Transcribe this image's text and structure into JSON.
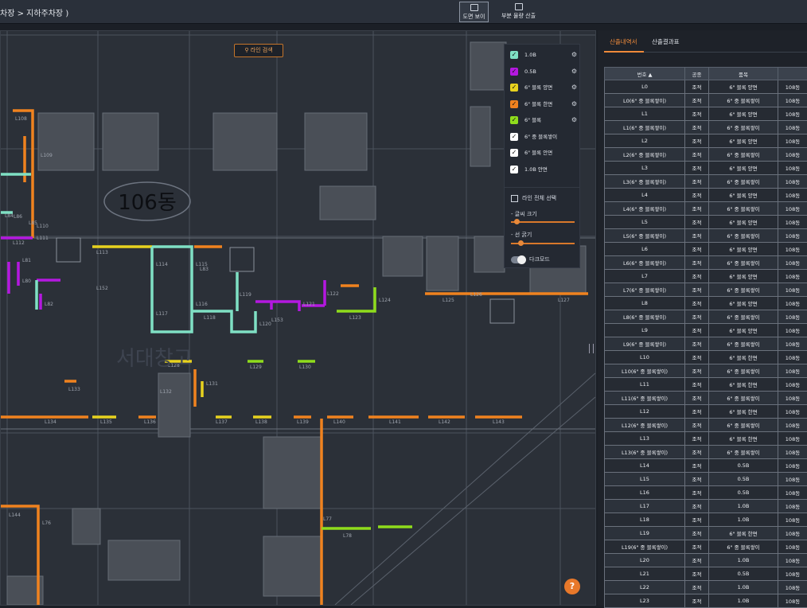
{
  "breadcrumb": "차장 > 지하주차장 )",
  "toolbar": {
    "view_label": "도면 보이",
    "view_icon": "print-icon",
    "partial_label": "부분 물량 산출",
    "partial_icon": "document-icon"
  },
  "plan": {
    "search_label": "라인 검색",
    "building_label": "106동",
    "room_label": "서대창고",
    "line_labels": [
      "L108",
      "L109",
      "L110",
      "L111",
      "L112",
      "L113",
      "L114",
      "L115",
      "L116",
      "L117",
      "L118",
      "L119",
      "L120",
      "L121",
      "L122",
      "L123",
      "L124",
      "L125",
      "L126",
      "L127",
      "L128",
      "L129",
      "L130",
      "L131",
      "L132",
      "L133",
      "L134",
      "L135",
      "L136",
      "L137",
      "L138",
      "L139",
      "L140",
      "L141",
      "L142",
      "L143",
      "L144",
      "L76",
      "L77",
      "L78",
      "L80",
      "L81",
      "L82",
      "L83",
      "L84",
      "L85",
      "L86",
      "L152",
      "L153"
    ]
  },
  "legend": [
    {
      "label": "1.0B",
      "color": "#7fe0c4"
    },
    {
      "label": "0.5B",
      "color": "#b418e0"
    },
    {
      "label": "6\" 블록 양면",
      "color": "#e8d21f"
    },
    {
      "label": "6\" 블록 한면",
      "color": "#f0821f"
    },
    {
      "label": "6\" 블록",
      "color": "#8fdc1c"
    },
    {
      "label": "6\" 중 블록쌓이",
      "color": "#ffffff"
    },
    {
      "label": "6\" 블록 안면",
      "color": "#ffffff"
    },
    {
      "label": "1.0B 안면",
      "color": "#ffffff"
    }
  ],
  "controls": {
    "select_all": "라인 전체 선택",
    "font_size": "- 글씨 크기",
    "line_width": "- 선 굵기",
    "dark_mode": "다크모드"
  },
  "help": "?",
  "panel": {
    "tabs": [
      "산출내역서",
      "산출결과표"
    ],
    "columns": [
      "번호 ▲",
      "공종",
      "품목",
      ""
    ],
    "rows": [
      [
        "L0",
        "조적",
        "6\" 블록 양면",
        "108동"
      ],
      [
        "L0(6\" 중 블록쌓이)",
        "조적",
        "6\" 중 블록쌓이",
        "108동"
      ],
      [
        "L1",
        "조적",
        "6\" 블록 양면",
        "108동"
      ],
      [
        "L1(6\" 중 블록쌓이)",
        "조적",
        "6\" 중 블록쌓이",
        "108동"
      ],
      [
        "L2",
        "조적",
        "6\" 블록 양면",
        "108동"
      ],
      [
        "L2(6\" 중 블록쌓이)",
        "조적",
        "6\" 중 블록쌓이",
        "108동"
      ],
      [
        "L3",
        "조적",
        "6\" 블록 양면",
        "108동"
      ],
      [
        "L3(6\" 중 블록쌓이)",
        "조적",
        "6\" 중 블록쌓이",
        "108동"
      ],
      [
        "L4",
        "조적",
        "6\" 블록 양면",
        "108동"
      ],
      [
        "L4(6\" 중 블록쌓이)",
        "조적",
        "6\" 중 블록쌓이",
        "108동"
      ],
      [
        "L5",
        "조적",
        "6\" 블록 양면",
        "108동"
      ],
      [
        "L5(6\" 중 블록쌓이)",
        "조적",
        "6\" 중 블록쌓이",
        "108동"
      ],
      [
        "L6",
        "조적",
        "6\" 블록 양면",
        "108동"
      ],
      [
        "L6(6\" 중 블록쌓이)",
        "조적",
        "6\" 중 블록쌓이",
        "108동"
      ],
      [
        "L7",
        "조적",
        "6\" 블록 양면",
        "108동"
      ],
      [
        "L7(6\" 중 블록쌓이)",
        "조적",
        "6\" 중 블록쌓이",
        "108동"
      ],
      [
        "L8",
        "조적",
        "6\" 블록 양면",
        "108동"
      ],
      [
        "L8(6\" 중 블록쌓이)",
        "조적",
        "6\" 중 블록쌓이",
        "108동"
      ],
      [
        "L9",
        "조적",
        "6\" 블록 양면",
        "108동"
      ],
      [
        "L9(6\" 중 블록쌓이)",
        "조적",
        "6\" 중 블록쌓이",
        "108동"
      ],
      [
        "L10",
        "조적",
        "6\" 블록 한면",
        "108동"
      ],
      [
        "L10(6\" 중 블록쌓이)",
        "조적",
        "6\" 중 블록쌓이",
        "108동"
      ],
      [
        "L11",
        "조적",
        "6\" 블록 한면",
        "108동"
      ],
      [
        "L11(6\" 중 블록쌓이)",
        "조적",
        "6\" 중 블록쌓이",
        "108동"
      ],
      [
        "L12",
        "조적",
        "6\" 블록 한면",
        "108동"
      ],
      [
        "L12(6\" 중 블록쌓이)",
        "조적",
        "6\" 중 블록쌓이",
        "108동"
      ],
      [
        "L13",
        "조적",
        "6\" 블록 한면",
        "108동"
      ],
      [
        "L13(6\" 중 블록쌓이)",
        "조적",
        "6\" 중 블록쌓이",
        "108동"
      ],
      [
        "L14",
        "조적",
        "0.5B",
        "108동"
      ],
      [
        "L15",
        "조적",
        "0.5B",
        "108동"
      ],
      [
        "L16",
        "조적",
        "0.5B",
        "108동"
      ],
      [
        "L17",
        "조적",
        "1.0B",
        "108동"
      ],
      [
        "L18",
        "조적",
        "1.0B",
        "108동"
      ],
      [
        "L19",
        "조적",
        "6\" 블록 한면",
        "108동"
      ],
      [
        "L19(6\" 중 블록쌓이)",
        "조적",
        "6\" 중 블록쌓이",
        "108동"
      ],
      [
        "L20",
        "조적",
        "1.0B",
        "108동"
      ],
      [
        "L21",
        "조적",
        "0.5B",
        "108동"
      ],
      [
        "L22",
        "조적",
        "1.0B",
        "108동"
      ],
      [
        "L23",
        "조적",
        "1.0B",
        "108동"
      ]
    ]
  }
}
